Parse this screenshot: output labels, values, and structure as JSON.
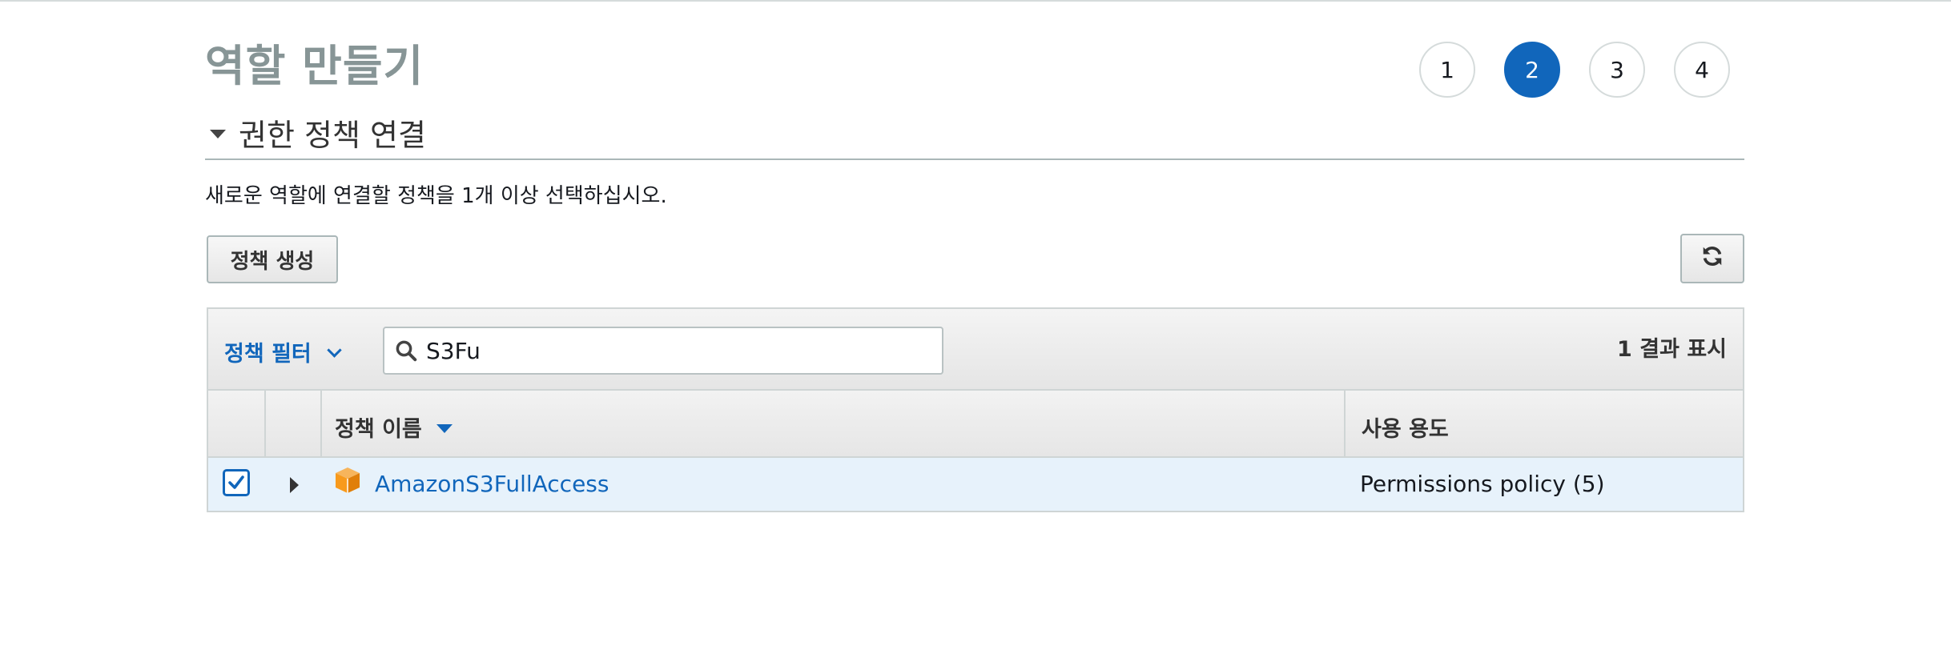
{
  "page": {
    "title": "역할 만들기",
    "steps": [
      "1",
      "2",
      "3",
      "4"
    ],
    "active_step": "2"
  },
  "section": {
    "title": "권한 정책 연결",
    "description": "새로운 역할에 연결할 정책을 1개 이상 선택하십시오."
  },
  "toolbar": {
    "create_policy_label": "정책 생성",
    "refresh_icon": "refresh-icon"
  },
  "filter": {
    "label": "정책 필터",
    "search_value": "S3Fu",
    "result_count": "1 결과 표시"
  },
  "table": {
    "columns": [
      "정책 이름",
      "사용 용도"
    ],
    "rows": [
      {
        "selected": true,
        "name": "AmazonS3FullAccess",
        "usage": "Permissions policy (5)",
        "icon": "aws-managed-policy-cube-icon"
      }
    ]
  },
  "colors": {
    "accent": "#1166bb",
    "selected_row_bg": "#e7f2fb",
    "policy_icon": "#f89a1c"
  }
}
